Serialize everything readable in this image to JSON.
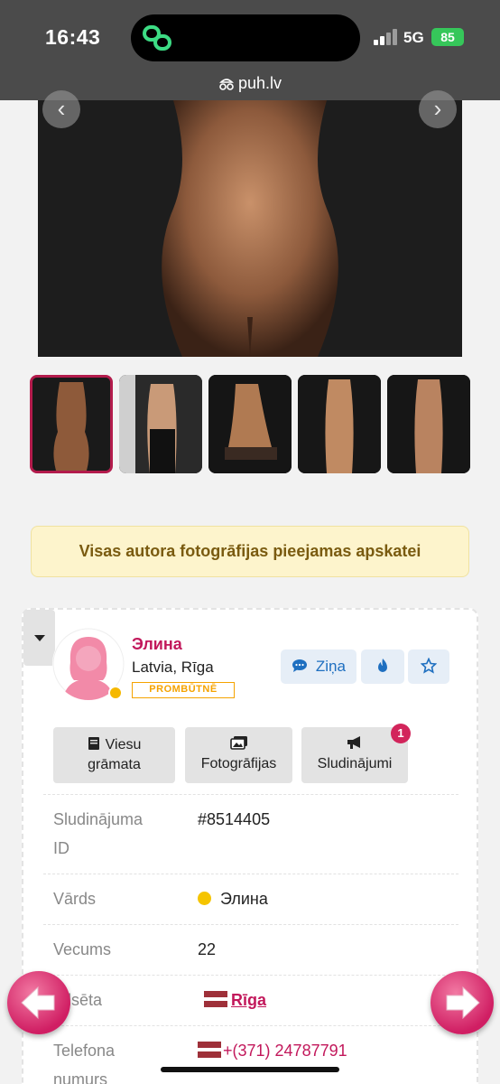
{
  "status_bar": {
    "time": "16:43",
    "network": "5G",
    "battery": "85",
    "url": "puh.lv"
  },
  "gallery": {
    "prev_icon": "chevron-left-icon",
    "next_icon": "chevron-right-icon",
    "thumbnails": 5,
    "active_thumbnail": 1
  },
  "notice": {
    "text": "Visas autora fotogrāfijas pieejamas apskatei"
  },
  "profile": {
    "name": "Элина",
    "location": "Latvia, Rīga",
    "status": "PROMBŪTNĒ",
    "status_color": "#f5a300",
    "online_color": "#f5b800",
    "message_label": "Ziņa",
    "fire_icon": "fire-icon",
    "star_icon": "star-icon"
  },
  "tabs": {
    "guestbook_line1": "Viesu",
    "guestbook_line2": "grāmata",
    "photos": "Fotogrāfijas",
    "ads": "Sludinājumi",
    "ads_count": "1"
  },
  "details": {
    "ad_id_label_1": "Sludinājuma",
    "ad_id_label_2": "ID",
    "ad_id_value": "#8514405",
    "name_label": "Vārds",
    "name_value": "Элина",
    "age_label": "Vecums",
    "age_value": "22",
    "city_label": "Pilsēta",
    "city_value": "Rīga",
    "phone_label_1": "Telefona",
    "phone_label_2": "numurs",
    "phone_value": "+(371) 24787791"
  },
  "colors": {
    "accent": "#c2185b",
    "status_bar": "#4b4b4b",
    "notice_bg": "#fdf4cc"
  }
}
